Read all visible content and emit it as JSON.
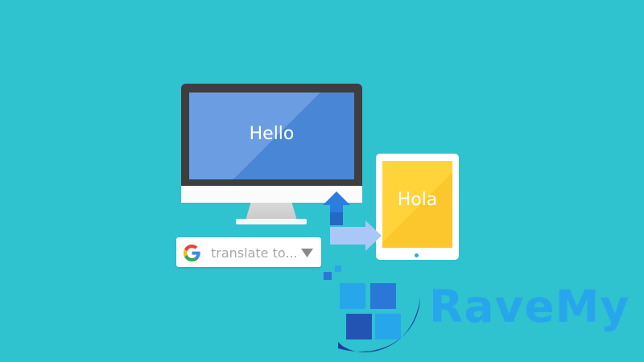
{
  "monitor": {
    "screen_text": "Hello"
  },
  "tablet": {
    "screen_text": "Hola"
  },
  "translate_box": {
    "text": "translate to..."
  },
  "watermark": {
    "text": "RaveMy"
  },
  "colors": {
    "background": "#2fc2cf",
    "monitor_screen": "#4a86d6",
    "tablet_screen": "#fcc72c",
    "watermark": "#27a6ec"
  },
  "icons": [
    "google-g-icon",
    "dropdown-arrow-icon",
    "sync-arrows-icon",
    "ravemy-logo-icon"
  ]
}
